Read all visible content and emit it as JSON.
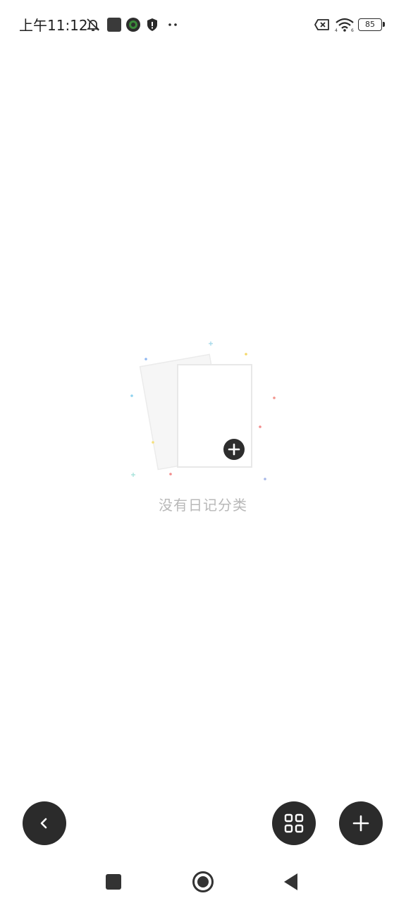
{
  "status_bar": {
    "time": "上午11:12",
    "battery_level": "85",
    "icons": [
      "mute-icon",
      "app-square-icon",
      "app-round-icon",
      "shield-icon",
      "more-dots-icon",
      "sim-x-icon",
      "wifi-icon",
      "battery-icon"
    ]
  },
  "empty_state": {
    "message": "没有日记分类",
    "icon": "empty-cards-add-icon"
  },
  "actions": {
    "back_icon": "chevron-left-icon",
    "grid_icon": "grid-icon",
    "add_icon": "plus-icon"
  },
  "nav_bar": {
    "icons": [
      "recents-square-icon",
      "home-circle-icon",
      "back-triangle-icon"
    ]
  },
  "colors": {
    "fab_background": "#2b2b2b",
    "empty_text": "#b8b8b8",
    "background": "#ffffff"
  }
}
